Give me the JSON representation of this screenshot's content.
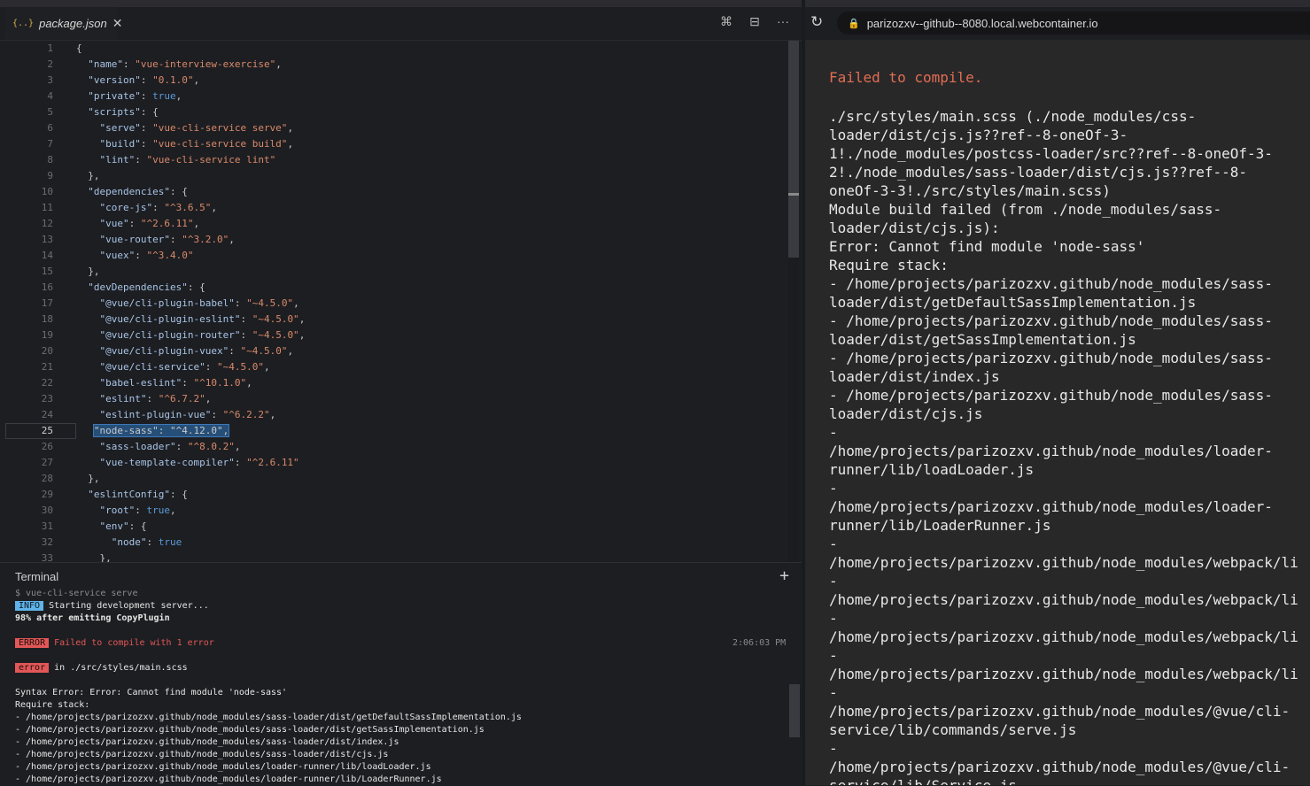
{
  "editor": {
    "tab": {
      "icon": "{..}",
      "label": "package.json",
      "close": "✕"
    },
    "actions": [
      "⌘",
      "⊟",
      "···"
    ],
    "current_line": 25,
    "lines": [
      [
        [
          "p",
          "{"
        ]
      ],
      [
        [
          "p",
          "  "
        ],
        [
          "k",
          "\"name\""
        ],
        [
          "p",
          ": "
        ],
        [
          "s",
          "\"vue-interview-exercise\""
        ],
        [
          "p",
          ","
        ]
      ],
      [
        [
          "p",
          "  "
        ],
        [
          "k",
          "\"version\""
        ],
        [
          "p",
          ": "
        ],
        [
          "s",
          "\"0.1.0\""
        ],
        [
          "p",
          ","
        ]
      ],
      [
        [
          "p",
          "  "
        ],
        [
          "k",
          "\"private\""
        ],
        [
          "p",
          ": "
        ],
        [
          "b",
          "true"
        ],
        [
          "p",
          ","
        ]
      ],
      [
        [
          "p",
          "  "
        ],
        [
          "k",
          "\"scripts\""
        ],
        [
          "p",
          ": {"
        ]
      ],
      [
        [
          "p",
          "    "
        ],
        [
          "k",
          "\"serve\""
        ],
        [
          "p",
          ": "
        ],
        [
          "s",
          "\"vue-cli-service serve\""
        ],
        [
          "p",
          ","
        ]
      ],
      [
        [
          "p",
          "    "
        ],
        [
          "k",
          "\"build\""
        ],
        [
          "p",
          ": "
        ],
        [
          "s",
          "\"vue-cli-service build\""
        ],
        [
          "p",
          ","
        ]
      ],
      [
        [
          "p",
          "    "
        ],
        [
          "k",
          "\"lint\""
        ],
        [
          "p",
          ": "
        ],
        [
          "s",
          "\"vue-cli-service lint\""
        ]
      ],
      [
        [
          "p",
          "  },"
        ]
      ],
      [
        [
          "p",
          "  "
        ],
        [
          "k",
          "\"dependencies\""
        ],
        [
          "p",
          ": {"
        ]
      ],
      [
        [
          "p",
          "    "
        ],
        [
          "k",
          "\"core-js\""
        ],
        [
          "p",
          ": "
        ],
        [
          "s",
          "\"^3.6.5\""
        ],
        [
          "p",
          ","
        ]
      ],
      [
        [
          "p",
          "    "
        ],
        [
          "k",
          "\"vue\""
        ],
        [
          "p",
          ": "
        ],
        [
          "s",
          "\"^2.6.11\""
        ],
        [
          "p",
          ","
        ]
      ],
      [
        [
          "p",
          "    "
        ],
        [
          "k",
          "\"vue-router\""
        ],
        [
          "p",
          ": "
        ],
        [
          "s",
          "\"^3.2.0\""
        ],
        [
          "p",
          ","
        ]
      ],
      [
        [
          "p",
          "    "
        ],
        [
          "k",
          "\"vuex\""
        ],
        [
          "p",
          ": "
        ],
        [
          "s",
          "\"^3.4.0\""
        ]
      ],
      [
        [
          "p",
          "  },"
        ]
      ],
      [
        [
          "p",
          "  "
        ],
        [
          "k",
          "\"devDependencies\""
        ],
        [
          "p",
          ": {"
        ]
      ],
      [
        [
          "p",
          "    "
        ],
        [
          "k",
          "\"@vue/cli-plugin-babel\""
        ],
        [
          "p",
          ": "
        ],
        [
          "s",
          "\"~4.5.0\""
        ],
        [
          "p",
          ","
        ]
      ],
      [
        [
          "p",
          "    "
        ],
        [
          "k",
          "\"@vue/cli-plugin-eslint\""
        ],
        [
          "p",
          ": "
        ],
        [
          "s",
          "\"~4.5.0\""
        ],
        [
          "p",
          ","
        ]
      ],
      [
        [
          "p",
          "    "
        ],
        [
          "k",
          "\"@vue/cli-plugin-router\""
        ],
        [
          "p",
          ": "
        ],
        [
          "s",
          "\"~4.5.0\""
        ],
        [
          "p",
          ","
        ]
      ],
      [
        [
          "p",
          "    "
        ],
        [
          "k",
          "\"@vue/cli-plugin-vuex\""
        ],
        [
          "p",
          ": "
        ],
        [
          "s",
          "\"~4.5.0\""
        ],
        [
          "p",
          ","
        ]
      ],
      [
        [
          "p",
          "    "
        ],
        [
          "k",
          "\"@vue/cli-service\""
        ],
        [
          "p",
          ": "
        ],
        [
          "s",
          "\"~4.5.0\""
        ],
        [
          "p",
          ","
        ]
      ],
      [
        [
          "p",
          "    "
        ],
        [
          "k",
          "\"babel-eslint\""
        ],
        [
          "p",
          ": "
        ],
        [
          "s",
          "\"^10.1.0\""
        ],
        [
          "p",
          ","
        ]
      ],
      [
        [
          "p",
          "    "
        ],
        [
          "k",
          "\"eslint\""
        ],
        [
          "p",
          ": "
        ],
        [
          "s",
          "\"^6.7.2\""
        ],
        [
          "p",
          ","
        ]
      ],
      [
        [
          "p",
          "    "
        ],
        [
          "k",
          "\"eslint-plugin-vue\""
        ],
        [
          "p",
          ": "
        ],
        [
          "s",
          "\"^6.2.2\""
        ],
        [
          "p",
          ","
        ]
      ],
      [
        [
          "p",
          "   "
        ],
        [
          "hl",
          "\"node-sass\": \"^4.12.0\","
        ]
      ],
      [
        [
          "p",
          "    "
        ],
        [
          "k",
          "\"sass-loader\""
        ],
        [
          "p",
          ": "
        ],
        [
          "s",
          "\"^8.0.2\""
        ],
        [
          "p",
          ","
        ]
      ],
      [
        [
          "p",
          "    "
        ],
        [
          "k",
          "\"vue-template-compiler\""
        ],
        [
          "p",
          ": "
        ],
        [
          "s",
          "\"^2.6.11\""
        ]
      ],
      [
        [
          "p",
          "  },"
        ]
      ],
      [
        [
          "p",
          "  "
        ],
        [
          "k",
          "\"eslintConfig\""
        ],
        [
          "p",
          ": {"
        ]
      ],
      [
        [
          "p",
          "    "
        ],
        [
          "k",
          "\"root\""
        ],
        [
          "p",
          ": "
        ],
        [
          "b",
          "true"
        ],
        [
          "p",
          ","
        ]
      ],
      [
        [
          "p",
          "    "
        ],
        [
          "k",
          "\"env\""
        ],
        [
          "p",
          ": {"
        ]
      ],
      [
        [
          "p",
          "      "
        ],
        [
          "k",
          "\"node\""
        ],
        [
          "p",
          ": "
        ],
        [
          "b",
          "true"
        ]
      ],
      [
        [
          "p",
          "    },"
        ]
      ]
    ]
  },
  "terminal": {
    "title": "Terminal",
    "add_label": "+",
    "command": "$ vue-cli-service serve",
    "info_badge": "INFO",
    "info_text": " Starting development server...",
    "progress": "98% after emitting CopyPlugin",
    "error_badge": "ERROR",
    "error_text": " Failed to compile with 1 error",
    "error_time": "2:06:03 PM",
    "error2_badge": "error",
    "error2_text": " in ./src/styles/main.scss",
    "syntax_error": "Syntax Error: Error: Cannot find module 'node-sass'",
    "require_stack": "Require stack:",
    "stack": [
      "- /home/projects/parizozxv.github/node_modules/sass-loader/dist/getDefaultSassImplementation.js",
      "- /home/projects/parizozxv.github/node_modules/sass-loader/dist/getSassImplementation.js",
      "- /home/projects/parizozxv.github/node_modules/sass-loader/dist/index.js",
      "- /home/projects/parizozxv.github/node_modules/sass-loader/dist/cjs.js",
      "- /home/projects/parizozxv.github/node_modules/loader-runner/lib/loadLoader.js",
      "- /home/projects/parizozxv.github/node_modules/loader-runner/lib/LoaderRunner.js"
    ]
  },
  "browser": {
    "reload_icon": "↻",
    "url": "parizozxv--github--8080.local.webcontainer.io",
    "error_title": "Failed to compile.",
    "error_body": "./src/styles/main.scss (./node_modules/css-\nloader/dist/cjs.js??ref--8-oneOf-3-\n1!./node_modules/postcss-loader/src??ref--8-oneOf-3-\n2!./node_modules/sass-loader/dist/cjs.js??ref--8-\noneOf-3-3!./src/styles/main.scss)\nModule build failed (from ./node_modules/sass-\nloader/dist/cjs.js):\nError: Cannot find module 'node-sass'\nRequire stack:\n- /home/projects/parizozxv.github/node_modules/sass-\nloader/dist/getDefaultSassImplementation.js\n- /home/projects/parizozxv.github/node_modules/sass-\nloader/dist/getSassImplementation.js\n- /home/projects/parizozxv.github/node_modules/sass-\nloader/dist/index.js\n- /home/projects/parizozxv.github/node_modules/sass-\nloader/dist/cjs.js\n-\n/home/projects/parizozxv.github/node_modules/loader-\nrunner/lib/loadLoader.js\n-\n/home/projects/parizozxv.github/node_modules/loader-\nrunner/lib/LoaderRunner.js\n-\n/home/projects/parizozxv.github/node_modules/webpack/li\n-\n/home/projects/parizozxv.github/node_modules/webpack/li\n-\n/home/projects/parizozxv.github/node_modules/webpack/li\n-\n/home/projects/parizozxv.github/node_modules/webpack/li\n-\n/home/projects/parizozxv.github/node_modules/@vue/cli-\nservice/lib/commands/serve.js\n-\n/home/projects/parizozxv.github/node_modules/@vue/cli-\nservice/lib/Service.js"
  }
}
